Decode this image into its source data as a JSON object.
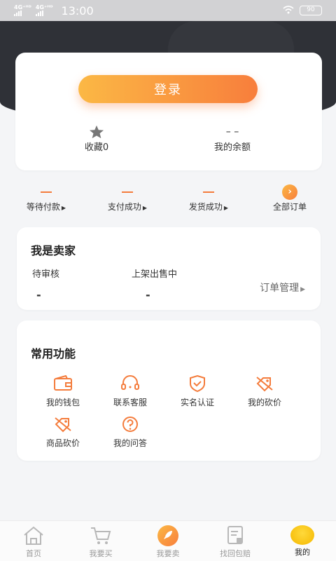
{
  "status_bar": {
    "network1": "4G⁺ᴴᴰ",
    "network2": "4G⁺ᴴᴰ",
    "time": "13:00",
    "battery": "90"
  },
  "login_card": {
    "login_label": "登录",
    "favorites_top": "",
    "favorites_label": "收藏0",
    "balance_top": "– –",
    "balance_label": "我的余额",
    "icons": {
      "favorites": "star-icon"
    }
  },
  "orders": {
    "items": [
      {
        "label": "等待付款",
        "icon": "dash"
      },
      {
        "label": "支付成功",
        "icon": "dash"
      },
      {
        "label": "发货成功",
        "icon": "dash"
      },
      {
        "label": "全部订单",
        "icon": "circle-arrow-icon"
      }
    ]
  },
  "seller": {
    "title": "我是卖家",
    "pending_label": "待审核",
    "pending_value": "-",
    "onsale_label": "上架出售中",
    "onsale_value": "-",
    "manage_label": "订单管理"
  },
  "functions": {
    "title": "常用功能",
    "items": [
      {
        "label": "我的钱包",
        "icon": "wallet-icon"
      },
      {
        "label": "联系客服",
        "icon": "headset-icon"
      },
      {
        "label": "实名认证",
        "icon": "shield-check-icon"
      },
      {
        "label": "我的砍价",
        "icon": "price-tag-cut-icon"
      },
      {
        "label": "商品砍价",
        "icon": "price-tag-cut-icon"
      },
      {
        "label": "我的问答",
        "icon": "question-circle-icon"
      }
    ]
  },
  "tabbar": {
    "items": [
      {
        "label": "首页",
        "icon": "home-icon",
        "active": false
      },
      {
        "label": "我要买",
        "icon": "cart-icon",
        "active": false
      },
      {
        "label": "我要卖",
        "icon": "rocket-icon",
        "active": false
      },
      {
        "label": "找回包赔",
        "icon": "receipt-icon",
        "active": false
      },
      {
        "label": "我的",
        "icon": "mine-icon",
        "active": true
      }
    ]
  },
  "colors": {
    "accent_start": "#fbb845",
    "accent_end": "#f87e3c",
    "icon_orange": "#f47c3c",
    "header_dark": "#2f3137"
  }
}
